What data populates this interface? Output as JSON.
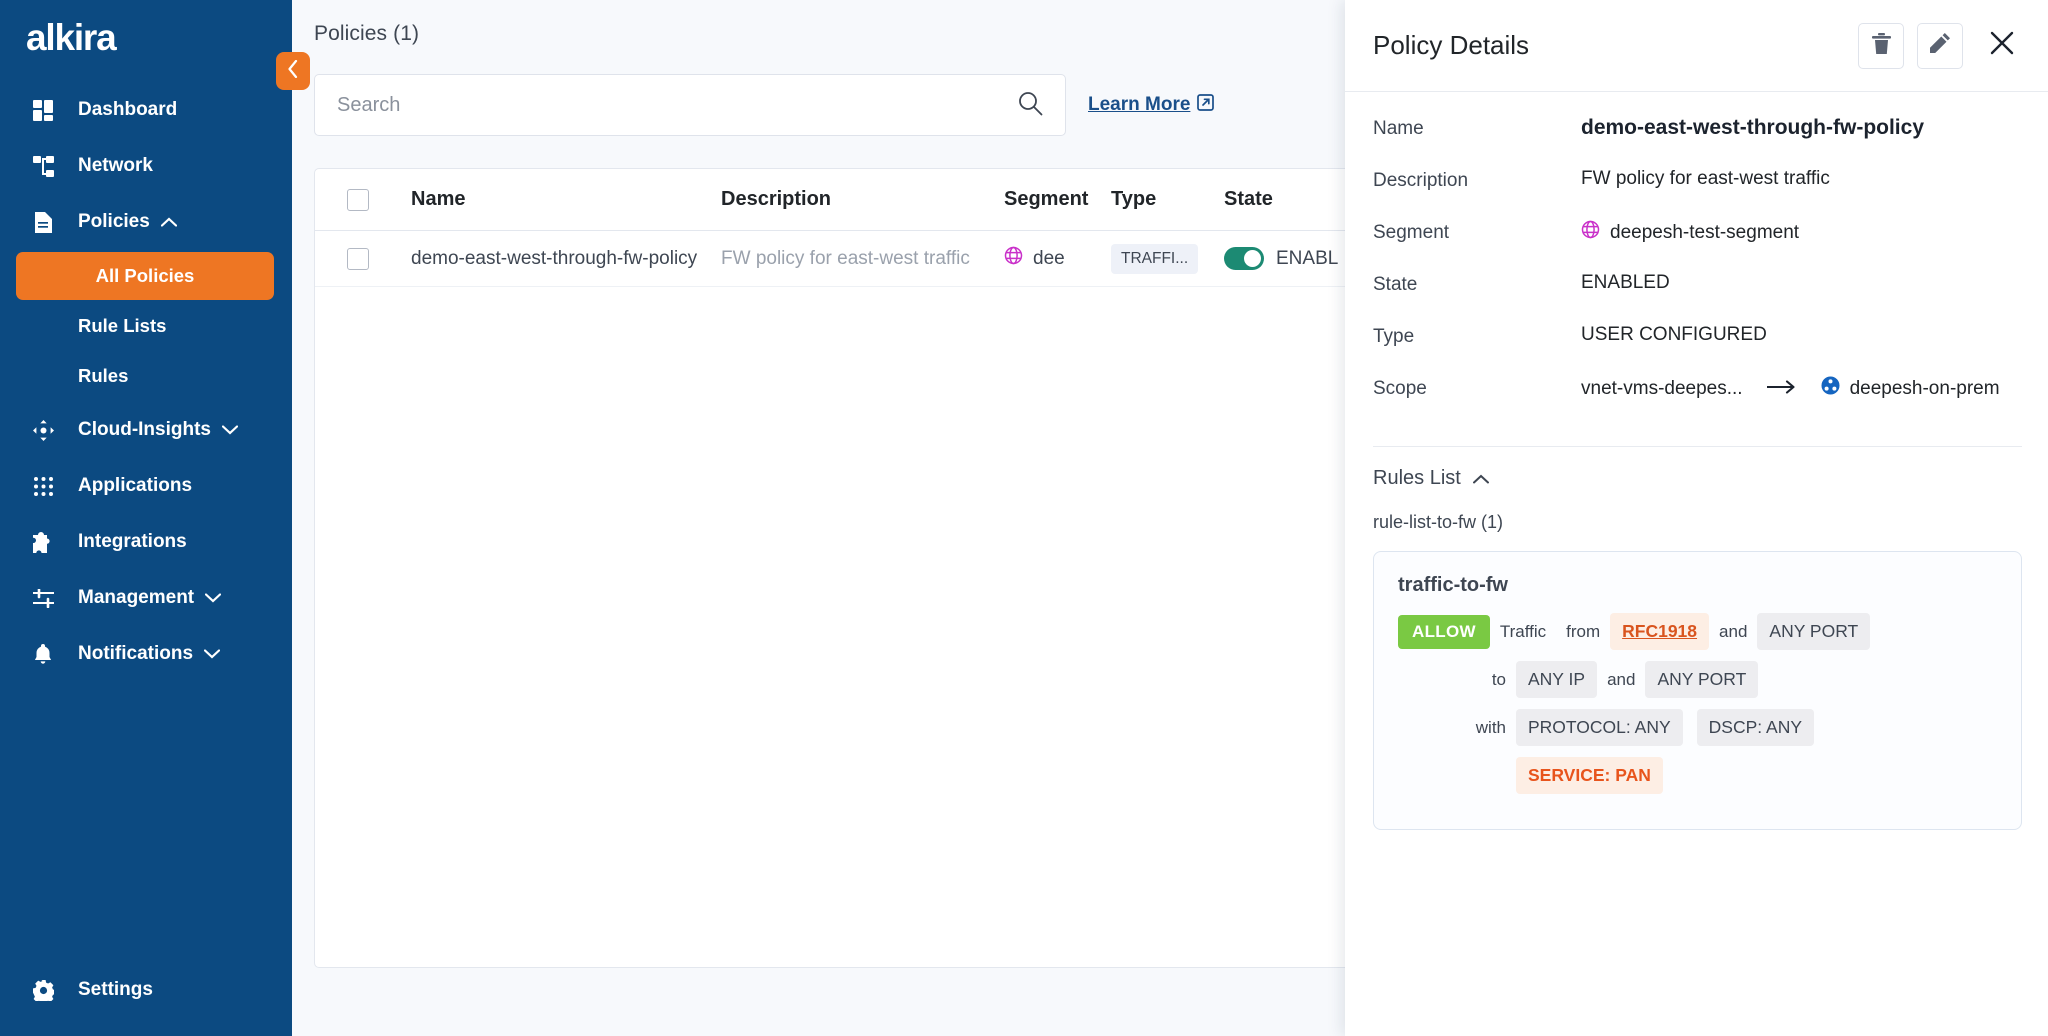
{
  "brand": {
    "logo_text": "alkira",
    "sidebar_color": "#0c4a81",
    "accent_color": "#ee7623"
  },
  "sidebar": {
    "items": [
      {
        "label": "Dashboard",
        "icon": "dashboard-icon"
      },
      {
        "label": "Network",
        "icon": "network-icon"
      },
      {
        "label": "Policies",
        "icon": "document-icon",
        "caret": "chevron-up-icon"
      }
    ],
    "policies_subitems": [
      {
        "label": "All Policies",
        "active": true
      },
      {
        "label": "Rule Lists",
        "active": false
      },
      {
        "label": "Rules",
        "active": false
      }
    ],
    "items_after": [
      {
        "label": "Cloud-Insights",
        "icon": "move-icon",
        "caret": "chevron-down-icon"
      },
      {
        "label": "Applications",
        "icon": "grid-icon"
      },
      {
        "label": "Integrations",
        "icon": "puzzle-icon"
      },
      {
        "label": "Management",
        "icon": "sliders-icon",
        "caret": "chevron-down-icon"
      },
      {
        "label": "Notifications",
        "icon": "bell-icon",
        "caret": "chevron-down-icon"
      }
    ],
    "settings": {
      "label": "Settings",
      "icon": "gear-icon"
    }
  },
  "main": {
    "page_title": "Policies (1)",
    "search": {
      "placeholder": "Search",
      "value": ""
    },
    "learn_more": "Learn More",
    "table": {
      "columns": [
        "Name",
        "Description",
        "Segment",
        "Type",
        "State"
      ],
      "rows": [
        {
          "name": "demo-east-west-through-fw-policy",
          "description": "FW policy for east-west traffic",
          "segment": "dee",
          "type": "TRAFFI...",
          "state": "ENABL",
          "state_on": true
        }
      ]
    }
  },
  "panel": {
    "title": "Policy Details",
    "actions": [
      {
        "name": "delete-button",
        "icon": "trash-icon"
      },
      {
        "name": "edit-button",
        "icon": "pencil-icon"
      },
      {
        "name": "close-button",
        "icon": "close-icon"
      }
    ],
    "fields": {
      "name_label": "Name",
      "name_value": "demo-east-west-through-fw-policy",
      "description_label": "Description",
      "description_value": "FW policy for east-west traffic",
      "segment_label": "Segment",
      "segment_value": "deepesh-test-segment",
      "state_label": "State",
      "state_value": "ENABLED",
      "type_label": "Type",
      "type_value": "USER CONFIGURED",
      "scope_label": "Scope",
      "scope_source": "vnet-vms-deepes...",
      "scope_target": "deepesh-on-prem"
    },
    "rules": {
      "section_title": "Rules List",
      "rule_list_name": "rule-list-to-fw (1)",
      "card": {
        "rule_name": "traffic-to-fw",
        "action_badge": "ALLOW",
        "line1": {
          "word1": "Traffic",
          "word2": "from",
          "chip1": "RFC1918",
          "conj": "and",
          "chip2": "ANY PORT"
        },
        "line2": {
          "lead": "to",
          "chip1": "ANY IP",
          "conj": "and",
          "chip2": "ANY PORT"
        },
        "line3": {
          "lead": "with",
          "chip1": "PROTOCOL: ANY",
          "chip2": "DSCP: ANY"
        },
        "line4": {
          "chip1": "SERVICE: PAN"
        }
      }
    }
  }
}
